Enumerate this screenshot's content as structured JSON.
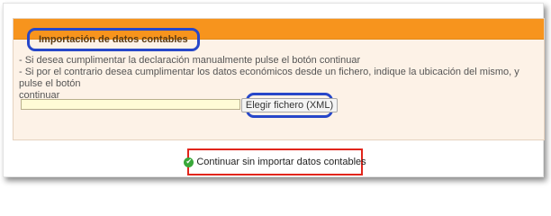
{
  "panel": {
    "title": "Importación de datos contables",
    "instructions": [
      "- Si desea cumplimentar la declaración manualmente pulse el botón continuar",
      "- Si por el contrario desea cumplimentar los datos económicos desde un fichero, indique la ubicación del mismo, y pulse el botón",
      "continuar"
    ],
    "file_input": {
      "value": "",
      "placeholder": ""
    },
    "file_button_label": "Elegir fichero (XML)"
  },
  "continue_button": {
    "label": "Continuar sin importar datos contables",
    "icon": "check-circle-icon"
  },
  "colors": {
    "header_orange": "#f7941d",
    "panel_background": "#fdf2e7",
    "input_background": "#fffbd6",
    "highlight_blue": "#2747c9",
    "highlight_red": "#e1251b",
    "check_green": "#3aa83a"
  }
}
